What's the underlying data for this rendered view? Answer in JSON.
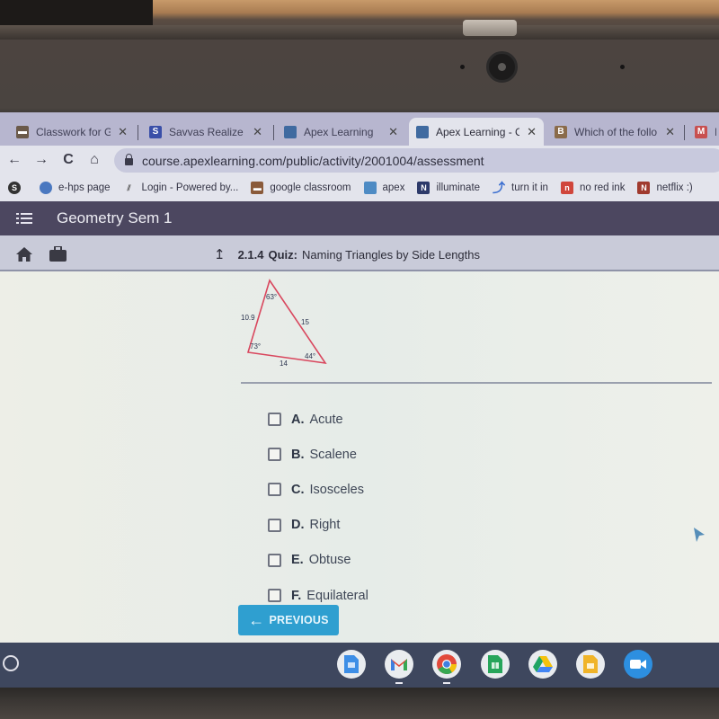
{
  "browser": {
    "tabs": [
      {
        "title": "Classwork for Geo",
        "favicon": "classroom-icon",
        "color": "#6b5a4a",
        "active": false
      },
      {
        "title": "Savvas Realize",
        "favicon": "savvas-icon",
        "color": "#3a4fa8",
        "active": false
      },
      {
        "title": "Apex Learning",
        "favicon": "apex-icon",
        "color": "#3f6aa0",
        "active": false
      },
      {
        "title": "Apex Learning - Co",
        "favicon": "apex-icon",
        "color": "#3f6aa0",
        "active": true
      },
      {
        "title": "Which of the follo",
        "favicon": "brainly-icon",
        "color": "#8a6b4a",
        "active": false
      },
      {
        "title": "In",
        "favicon": "gmail-icon",
        "color": "#c85050",
        "active": false
      }
    ],
    "close_glyph": "✕",
    "nav": {
      "back": "←",
      "forward": "→",
      "reload": "C",
      "home": "⌂"
    },
    "url": "course.apexlearning.com/public/activity/2001004/assessment",
    "bookmarks": [
      {
        "label": "",
        "icon": "apps-icon"
      },
      {
        "label": "e-hps page",
        "icon": "globe-icon"
      },
      {
        "label": "Login - Powered by...",
        "icon": "login-icon"
      },
      {
        "label": "google classroom",
        "icon": "classroom-icon"
      },
      {
        "label": "apex",
        "icon": "apex-icon"
      },
      {
        "label": "illuminate",
        "icon": "illuminate-icon"
      },
      {
        "label": "turn it in",
        "icon": "turnitin-icon"
      },
      {
        "label": "no red ink",
        "icon": "noredink-icon"
      },
      {
        "label": "netflix :)",
        "icon": "netflix-icon"
      }
    ]
  },
  "app": {
    "course_title": "Geometry Sem 1",
    "quiz_number": "2.1.4",
    "quiz_label": "Quiz:",
    "quiz_name": "Naming Triangles by Side Lengths"
  },
  "triangle": {
    "sides": {
      "left": "10.9",
      "right": "15",
      "bottom": "14"
    },
    "angles": {
      "top": "63°",
      "bottom_left": "73°",
      "bottom_right": "44°"
    },
    "stroke_color": "#d9475e"
  },
  "options": [
    {
      "letter": "A.",
      "text": "Acute",
      "checked": false
    },
    {
      "letter": "B.",
      "text": "Scalene",
      "checked": false
    },
    {
      "letter": "C.",
      "text": "Isosceles",
      "checked": false
    },
    {
      "letter": "D.",
      "text": "Right",
      "checked": false
    },
    {
      "letter": "E.",
      "text": "Obtuse",
      "checked": false
    },
    {
      "letter": "F.",
      "text": "Equilateral",
      "checked": false
    }
  ],
  "buttons": {
    "previous": "PREVIOUS",
    "previous_arrow": "←"
  },
  "shelf": {
    "apps": [
      "docs-icon",
      "gmail-icon",
      "chrome-icon",
      "sheets-icon",
      "drive-icon",
      "slides-icon",
      "meet-icon"
    ]
  },
  "colors": {
    "accent": "#2f9fd0",
    "header": "#4c4760",
    "subheader": "#c9cbd9"
  }
}
